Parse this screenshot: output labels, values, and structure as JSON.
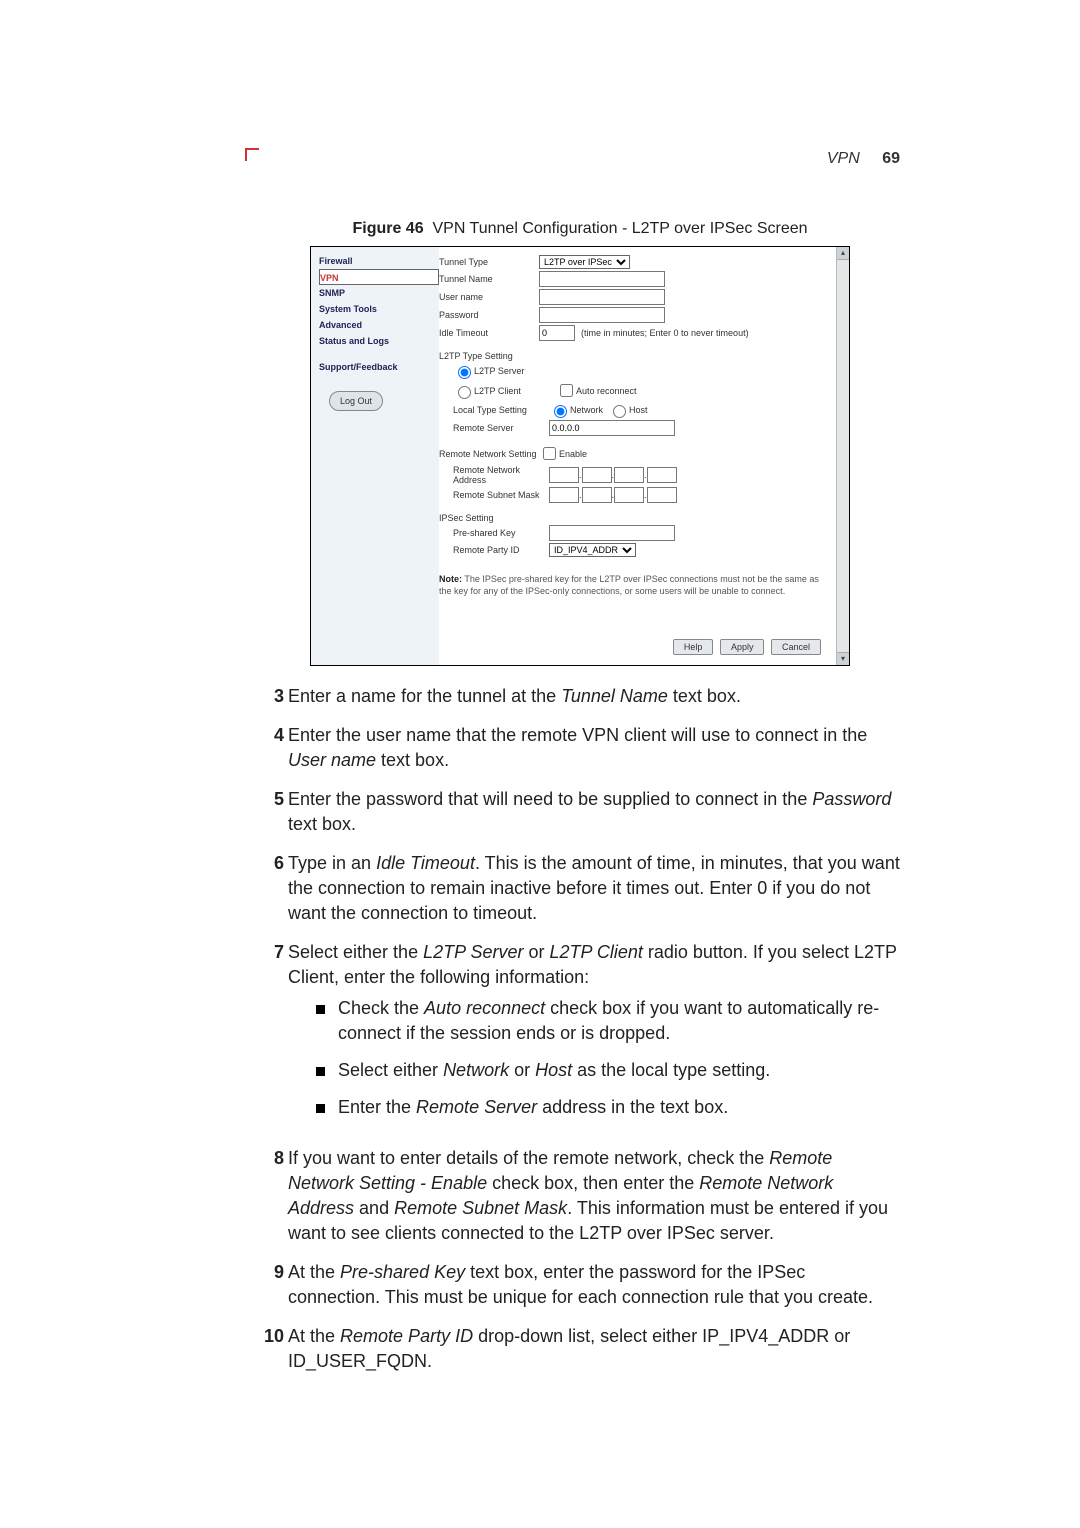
{
  "header": {
    "section": "VPN",
    "page": "69"
  },
  "figure": {
    "label": "Figure 46",
    "caption": "VPN Tunnel Configuration - L2TP over IPSec Screen"
  },
  "shot": {
    "nav": [
      "Firewall",
      "VPN",
      "SNMP",
      "System Tools",
      "Advanced",
      "Status and Logs"
    ],
    "nav_group": "Support/Feedback",
    "logout": "Log Out",
    "rows": {
      "tunnel_type_lbl": "Tunnel Type",
      "tunnel_type_val": "L2TP over IPSec",
      "tunnel_name_lbl": "Tunnel Name",
      "user_name_lbl": "User name",
      "password_lbl": "Password",
      "idle_lbl": "Idle Timeout",
      "idle_val": "0",
      "idle_hint": "(time in minutes; Enter 0 to never timeout)"
    },
    "l2tp": {
      "heading": "L2TP Type Setting",
      "server": "L2TP Server",
      "client": "L2TP Client",
      "auto": "Auto reconnect",
      "local_lbl": "Local Type Setting",
      "network": "Network",
      "host": "Host",
      "remote_server_lbl": "Remote Server",
      "remote_server_val": "0.0.0.0"
    },
    "remote": {
      "heading": "Remote Network Setting",
      "enable": "Enable",
      "addr_lbl": "Remote Network Address",
      "mask_lbl": "Remote Subnet Mask"
    },
    "ipsec": {
      "heading": "IPSec Setting",
      "psk_lbl": "Pre-shared Key",
      "party_lbl": "Remote Party ID",
      "party_val": "ID_IPV4_ADDR"
    },
    "note_b": "Note:",
    "note": " The IPSec pre-shared key for the L2TP over IPSec connections must not be the same as the key for any of the IPSec-only connections, or some users will be unable to connect.",
    "buttons": {
      "help": "Help",
      "apply": "Apply",
      "cancel": "Cancel"
    }
  },
  "steps": {
    "s3_a": "Enter a name for the tunnel at the ",
    "s3_i": "Tunnel Name",
    "s3_b": " text box.",
    "s4_a": "Enter the user name that the remote VPN client will use to connect in the ",
    "s4_i": "User name",
    "s4_b": " text box.",
    "s5_a": "Enter the password that will need to be supplied to connect in the ",
    "s5_i": "Password",
    "s5_b": " text box.",
    "s6_a": "Type in an ",
    "s6_i": "Idle Timeout",
    "s6_b": ". This is the amount of time, in minutes, that you want the connection to remain inactive before it times out. Enter 0 if you do not want the connection to timeout.",
    "s7_a": "Select either the ",
    "s7_i1": "L2TP Server",
    "s7_mid": " or ",
    "s7_i2": "L2TP Client",
    "s7_b": " radio button. If you select L2TP Client, enter the following information:",
    "s7_sub1_a": "Check the ",
    "s7_sub1_i": "Auto reconnect",
    "s7_sub1_b": " check box if you want to automatically re-connect if the session ends or is dropped.",
    "s7_sub2_a": "Select either ",
    "s7_sub2_i1": "Network",
    "s7_sub2_mid": " or ",
    "s7_sub2_i2": "Host",
    "s7_sub2_b": " as the local type setting.",
    "s7_sub3_a": "Enter the ",
    "s7_sub3_i": "Remote Server",
    "s7_sub3_b": " address in the text box.",
    "s8_a": "If you want to enter details of the remote network, check the ",
    "s8_i1": "Remote Network Setting - Enable",
    "s8_mid1": " check box, then enter the ",
    "s8_i2": "Remote Network Address",
    "s8_mid2": " and ",
    "s8_i3": "Remote Subnet Mask",
    "s8_b": ". This information must be entered if you want to see clients connected to the L2TP over IPSec server.",
    "s9_a": "At the ",
    "s9_i": "Pre-shared Key",
    "s9_b": " text box, enter the password for the IPSec connection. This must be unique for each connection rule that you create.",
    "s10_a": "At the ",
    "s10_i": "Remote Party ID",
    "s10_b": " drop-down list, select either IP_IPV4_ADDR or ID_USER_FQDN."
  },
  "nums": {
    "n3": "3",
    "n4": "4",
    "n5": "5",
    "n6": "6",
    "n7": "7",
    "n8": "8",
    "n9": "9",
    "n10": "10"
  }
}
